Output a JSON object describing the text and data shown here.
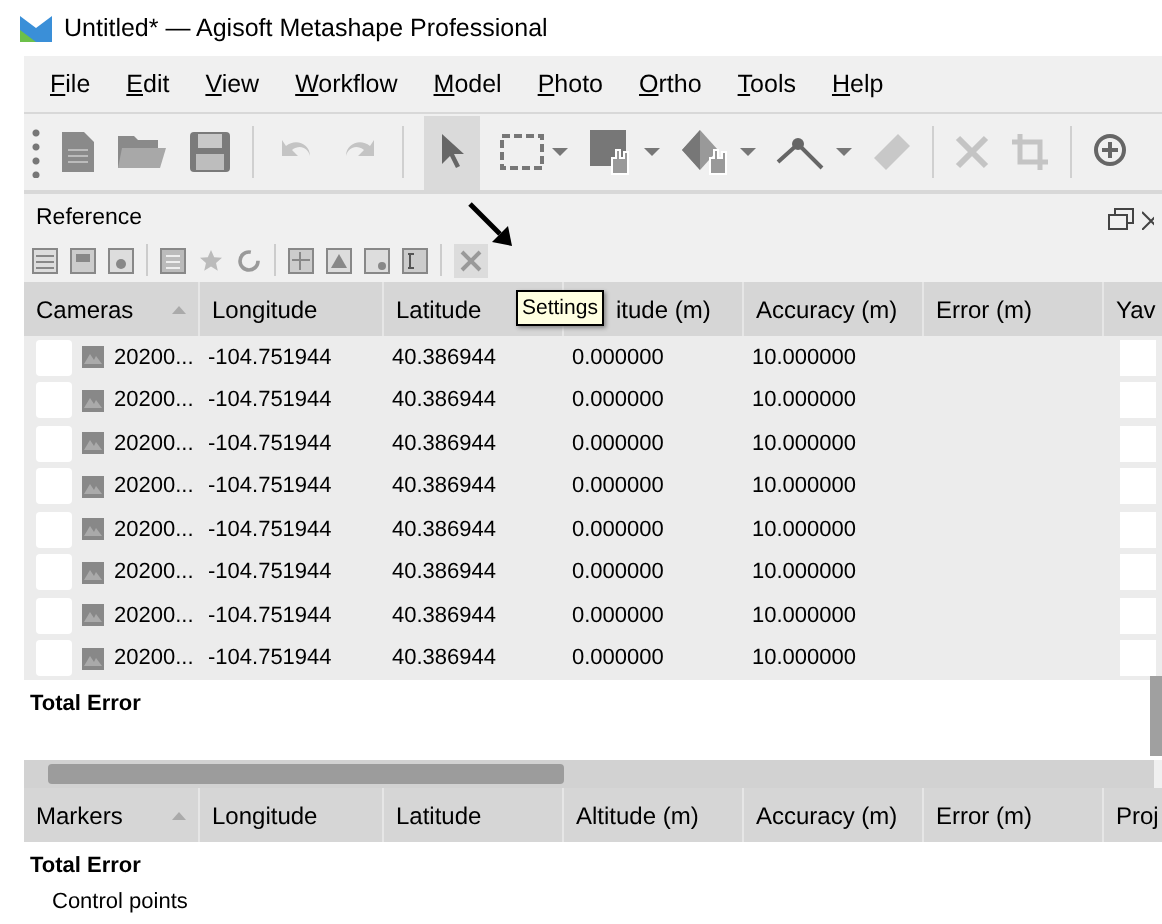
{
  "window": {
    "title": "Untitled* — Agisoft Metashape Professional"
  },
  "menu": [
    "File",
    "Edit",
    "View",
    "Workflow",
    "Model",
    "Photo",
    "Ortho",
    "Tools",
    "Help"
  ],
  "panel": {
    "title": "Reference"
  },
  "tooltip": {
    "text": "Settings"
  },
  "cameras_table": {
    "columns": [
      "Cameras",
      "Longitude",
      "Latitude",
      "itude (m)",
      "Accuracy (m)",
      "Error (m)",
      "Yav"
    ],
    "rows": [
      {
        "checked": false,
        "label": "20200...",
        "longitude": "-104.751944",
        "latitude": "40.386944",
        "altitude": "0.000000",
        "accuracy": "10.000000"
      },
      {
        "checked": false,
        "label": "20200...",
        "longitude": "-104.751944",
        "latitude": "40.386944",
        "altitude": "0.000000",
        "accuracy": "10.000000"
      },
      {
        "checked": false,
        "label": "20200...",
        "longitude": "-104.751944",
        "latitude": "40.386944",
        "altitude": "0.000000",
        "accuracy": "10.000000"
      },
      {
        "checked": false,
        "label": "20200...",
        "longitude": "-104.751944",
        "latitude": "40.386944",
        "altitude": "0.000000",
        "accuracy": "10.000000"
      },
      {
        "checked": false,
        "label": "20200...",
        "longitude": "-104.751944",
        "latitude": "40.386944",
        "altitude": "0.000000",
        "accuracy": "10.000000"
      },
      {
        "checked": false,
        "label": "20200...",
        "longitude": "-104.751944",
        "latitude": "40.386944",
        "altitude": "0.000000",
        "accuracy": "10.000000"
      },
      {
        "checked": false,
        "label": "20200...",
        "longitude": "-104.751944",
        "latitude": "40.386944",
        "altitude": "0.000000",
        "accuracy": "10.000000"
      },
      {
        "checked": false,
        "label": "20200...",
        "longitude": "-104.751944",
        "latitude": "40.386944",
        "altitude": "0.000000",
        "accuracy": "10.000000"
      }
    ],
    "total_row": "Total Error"
  },
  "markers_table": {
    "columns": [
      "Markers",
      "Longitude",
      "Latitude",
      "Altitude (m)",
      "Accuracy (m)",
      "Error (m)",
      "Proj"
    ],
    "total_row": "Total Error",
    "groups": [
      "Control points"
    ]
  }
}
